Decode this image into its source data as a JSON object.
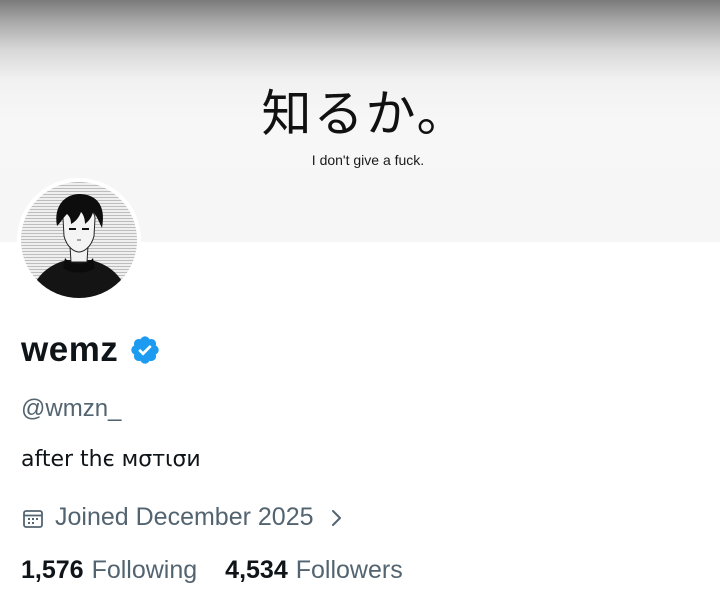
{
  "banner": {
    "jp_text": "知るか。",
    "en_text": "I don't give a fuck."
  },
  "profile": {
    "display_name": "wemz",
    "verified": true,
    "handle": "@wmzn_",
    "bio": "after thє мσтισи",
    "joined": "Joined December 2025"
  },
  "stats": {
    "following_count": "1,576",
    "following_label": "Following",
    "followers_count": "4,534",
    "followers_label": "Followers"
  },
  "colors": {
    "primary_text": "#0f1419",
    "secondary_text": "#536471",
    "verified_blue": "#1d9bf0"
  },
  "icons": {
    "verified": "verified-badge-icon",
    "calendar": "calendar-icon",
    "chevron": "chevron-right-icon"
  }
}
